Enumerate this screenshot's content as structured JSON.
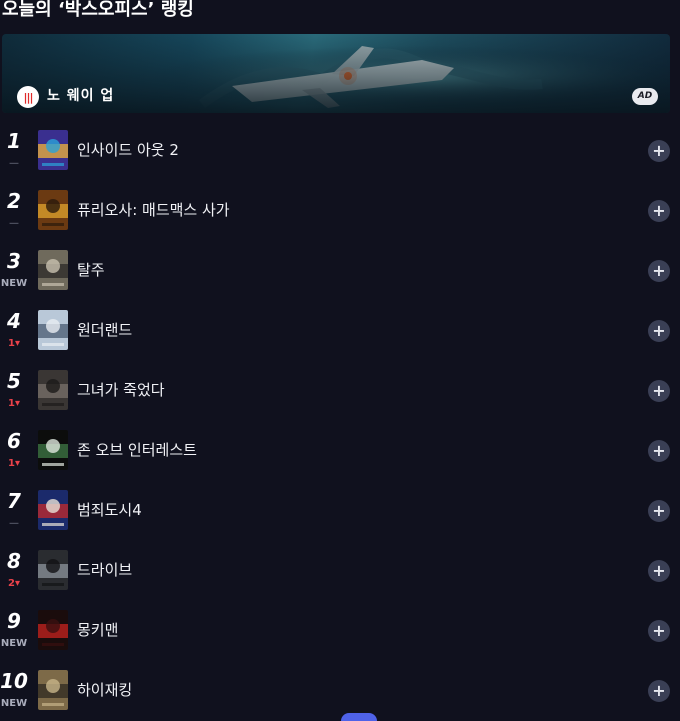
{
  "section": {
    "title": "오늘의 ‘박스오피스’ 랭킹"
  },
  "ad": {
    "brand_logo_icon": "netflix-bars-icon",
    "title": "노 웨이 업",
    "badge": "AD",
    "logo_glyph": "|||"
  },
  "rankings": [
    {
      "rank": "1",
      "change": "—",
      "change_type": "same",
      "title": "인사이드 아웃 2",
      "poster_colors": [
        "#3a2f8f",
        "#f2b437",
        "#2ba3d9"
      ]
    },
    {
      "rank": "2",
      "change": "—",
      "change_type": "same",
      "title": "퓨리오사: 매드맥스 사가",
      "poster_colors": [
        "#6b3a12",
        "#e0a42d",
        "#2a1a0c"
      ]
    },
    {
      "rank": "3",
      "change": "NEW",
      "change_type": "new",
      "title": "탈주",
      "poster_colors": [
        "#6f6a5c",
        "#2b2a27",
        "#c9c2b0"
      ]
    },
    {
      "rank": "4",
      "change": "1▾",
      "change_type": "down",
      "title": "원더랜드",
      "poster_colors": [
        "#b9c8d8",
        "#4a5b72",
        "#e9eef3"
      ]
    },
    {
      "rank": "5",
      "change": "1▾",
      "change_type": "down",
      "title": "그녀가 죽었다",
      "poster_colors": [
        "#3a3634",
        "#7a726b",
        "#1c1a19"
      ]
    },
    {
      "rank": "6",
      "change": "1▾",
      "change_type": "down",
      "title": "존 오브 인터레스트",
      "poster_colors": [
        "#0c0d0c",
        "#3f7a45",
        "#dfe7dd"
      ]
    },
    {
      "rank": "7",
      "change": "—",
      "change_type": "same",
      "title": "범죄도시4",
      "poster_colors": [
        "#1b2a6b",
        "#c52a2a",
        "#e8e2d8"
      ]
    },
    {
      "rank": "8",
      "change": "2▾",
      "change_type": "down",
      "title": "드라이브",
      "poster_colors": [
        "#2a2c30",
        "#8e949c",
        "#111214"
      ]
    },
    {
      "rank": "9",
      "change": "NEW",
      "change_type": "new",
      "title": "몽키맨",
      "poster_colors": [
        "#1a0c0c",
        "#c8231f",
        "#3b1010"
      ]
    },
    {
      "rank": "10",
      "change": "NEW",
      "change_type": "new",
      "title": "하이재킹",
      "poster_colors": [
        "#7d6a48",
        "#2f2a20",
        "#c8b58a"
      ]
    }
  ],
  "add_icon": "plus-circle-icon",
  "add_glyph": "+"
}
